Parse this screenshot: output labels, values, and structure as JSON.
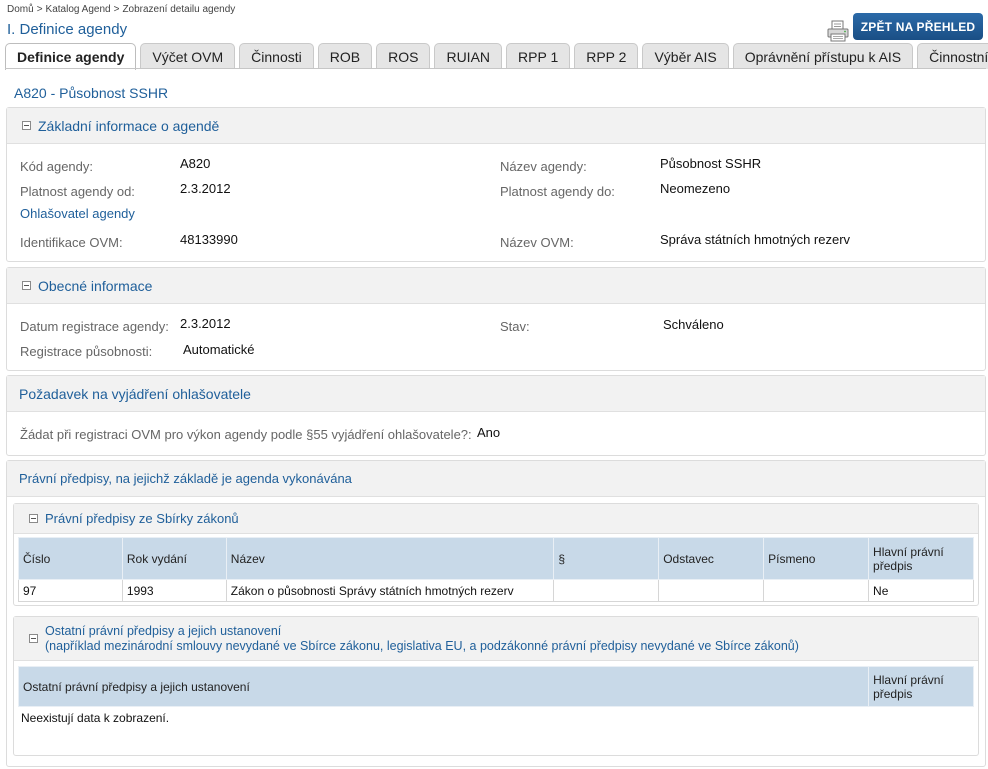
{
  "breadcrumb": [
    "Domů",
    "Katalog Agend",
    "Zobrazení detailu agendy"
  ],
  "page_title": "I. Definice agendy",
  "back_button": "ZPĚT NA PŘEHLED",
  "tabs": [
    "Definice agendy",
    "Výčet OVM",
    "Činnosti",
    "ROB",
    "ROS",
    "RUIAN",
    "RPP 1",
    "RPP 2",
    "Výběr AIS",
    "Oprávnění přístupu k AIS",
    "Činnostní role"
  ],
  "active_tab": 0,
  "agenda_heading": "A820 - Působnost SSHR",
  "basic": {
    "title": "Základní informace o agendě",
    "kod_label": "Kód agendy:",
    "kod_value": "A820",
    "nazev_label": "Název agendy:",
    "nazev_value": "Působnost SSHR",
    "od_label": "Platnost agendy od:",
    "od_value": "2.3.2012",
    "do_label": "Platnost agendy do:",
    "do_value": "Neomezeno",
    "ohlasovatel_link": "Ohlašovatel agendy",
    "ident_label": "Identifikace OVM:",
    "ident_value": "48133990",
    "ovm_label": "Název OVM:",
    "ovm_value": "Správa státních hmotných rezerv"
  },
  "general": {
    "title": "Obecné informace",
    "datum_label": "Datum registrace agendy:",
    "datum_value": "2.3.2012",
    "stav_label": "Stav:",
    "stav_value": "Schváleno",
    "reg_label": "Registrace působnosti:",
    "reg_value": "Automatické"
  },
  "request": {
    "title": "Požadavek na vyjádření ohlašovatele",
    "label": "Žádat při registraci OVM pro výkon agendy podle §55 vyjádření ohlašovatele?:",
    "value": "Ano"
  },
  "legal": {
    "title": "Právní předpisy, na jejichž základě je agenda vykonávána",
    "sbirka": {
      "title": "Právní předpisy ze Sbírky zákonů",
      "columns": [
        "Číslo",
        "Rok vydání",
        "Název",
        "§",
        "Odstavec",
        "Písmeno",
        "Hlavní právní předpis"
      ],
      "rows": [
        [
          "97",
          "1993",
          "Zákon o působnosti Správy státních hmotných rezerv",
          "",
          "",
          "",
          "Ne"
        ]
      ]
    },
    "ostatni": {
      "title_line1": "Ostatní právní předpisy a jejich ustanovení",
      "title_line2": "(například mezinárodní smlouvy nevydané ve Sbírce zákonu, legislativa EU, a podzákonné právní předpisy nevydané ve Sbírce zákonů)",
      "columns": [
        "Ostatní právní předpisy a jejich ustanovení",
        "Hlavní právní předpis"
      ],
      "empty_text": "Neexistují data k zobrazení."
    }
  },
  "colors": {
    "link": "#1f5f9a",
    "button": "#1a4f85",
    "table_header": "#c8d9e8",
    "panel_header": "#f2f2f2"
  },
  "icons": [
    "print-icon",
    "collapse-toggle-icon"
  ]
}
